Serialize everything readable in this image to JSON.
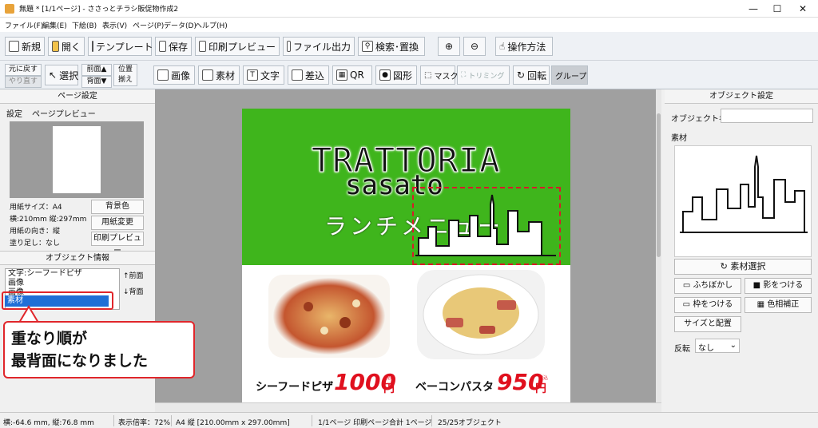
{
  "window": {
    "title": "無題 * [1/1ページ] - ささっとチラシ販促物作成2",
    "controls": [
      "—",
      "☐",
      "✕"
    ]
  },
  "menu": [
    "ファイル(F)",
    "編集(E)",
    "下絵(B)",
    "表示(V)",
    "ページ(P)",
    "データ(D)",
    "ヘルプ(H)"
  ],
  "toolbar1": {
    "new": "新規",
    "open": "開く",
    "template": "テンプレート",
    "save": "保存",
    "print_preview": "印刷プレビュー",
    "file_output": "ファイル出力",
    "search_replace": "検索･置換",
    "howto": "操作方法"
  },
  "toolbar2": {
    "undo": "元に戻す",
    "redo": "やり直す",
    "select": "選択",
    "front": "前面▲",
    "back": "背面▼",
    "align1": "位置",
    "align2": "揃え",
    "image": "画像",
    "material": "素材",
    "text": "文字",
    "merge": "差込",
    "qr": "QR",
    "shape": "図形",
    "mask": "マスク",
    "trim": "トリミング",
    "rotate": "回転",
    "group": "グループ"
  },
  "page_settings": {
    "header": "ページ設定",
    "tab_settings": "設定",
    "tab_preview": "ページプレビュー",
    "paper_size": "用紙サイズ：A4",
    "dims": "横:210mm 縦:297mm",
    "orientation": "用紙の向き：縦",
    "bleed": "塗り足し：なし",
    "bg_color": "背景色",
    "change_paper": "用紙変更",
    "print_preview": "印刷プレビュー"
  },
  "object_info": {
    "header": "オブジェクト情報",
    "items": [
      "文字:シーフードピザ",
      "画像",
      "画像",
      "素材"
    ],
    "front": "↑前面",
    "back": "↓背面"
  },
  "callout": {
    "line1": "重なり順が",
    "line2": "最背面になりました"
  },
  "flyer": {
    "title": "TRATTORIA",
    "subtitle": "sasato",
    "menu_title": "ランチメニュー",
    "item1_name": "シーフードピザ",
    "item1_price": "1000",
    "item1_tax": "税込",
    "item2_name": "ベーコンパスタ",
    "item2_price": "950",
    "item2_tax": "税込",
    "currency": "円"
  },
  "object_settings": {
    "header": "オブジェクト設定",
    "name_label": "オブジェクト名",
    "name_value": "",
    "tab": "素材",
    "select_material": "素材選択",
    "blur": "ふちぼかし",
    "shadow": "影をつける",
    "frame": "枠をつける",
    "color_correct": "色相補正",
    "size_position": "サイズと配置",
    "flip_label": "反転",
    "flip_value": "なし"
  },
  "status": {
    "coords": "横:-64.6 mm, 縦:76.8 mm",
    "zoom": "表示倍率：72%",
    "paper": "A4 縦 [210.00mm x 297.00mm]",
    "pages": "1/1ページ 印刷ページ合計 1ページ",
    "objects": "25/25オブジェクト"
  },
  "colors": {
    "green": "#3fb51c",
    "price_red": "#e0101e",
    "callout_red": "#e0262b",
    "selection_blue": "#1f6fd6"
  }
}
